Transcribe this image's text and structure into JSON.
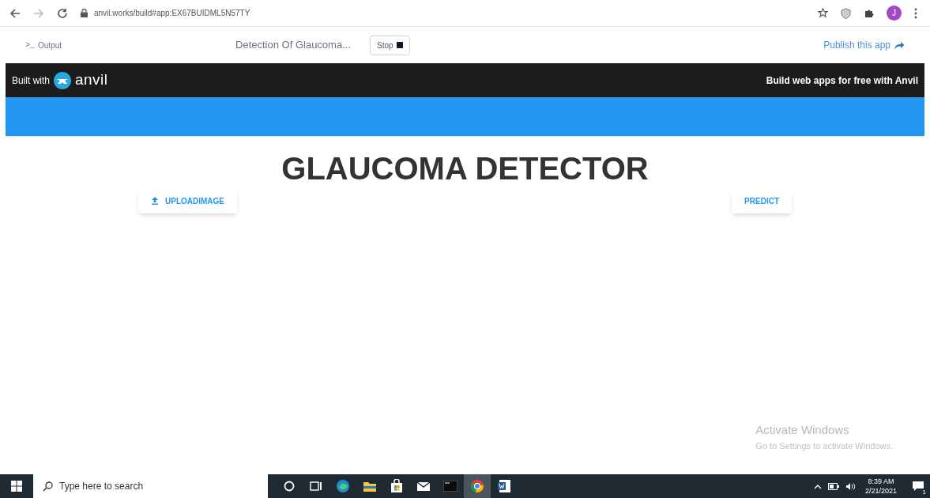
{
  "browser": {
    "url": "anvil.works/build#app:EX67BUIDML5N57TY",
    "avatar": "J"
  },
  "app_header": {
    "output_label": "Output",
    "output_glyph": ">_",
    "title": "Detection Of Glaucoma...",
    "stop_label": "Stop",
    "publish_label": "Publish this app"
  },
  "anvil_bar": {
    "built_with": "Built with",
    "logo_text": "anvil",
    "tagline": "Build web apps for free with Anvil"
  },
  "page": {
    "heading": "GLAUCOMA DETECTOR",
    "buttons": [
      {
        "label": "UPLOADIMAGE",
        "kind": "upload"
      },
      {
        "label": "PREDICT",
        "kind": "plain"
      }
    ]
  },
  "activation": {
    "title": "Activate Windows",
    "subtitle": "Go to Settings to activate Windows."
  },
  "taskbar": {
    "search_placeholder": "Type here to search",
    "apps": [
      {
        "kind": "cortana",
        "selected": false
      },
      {
        "kind": "taskview",
        "selected": false
      },
      {
        "kind": "edge",
        "selected": false
      },
      {
        "kind": "explorer",
        "selected": false
      },
      {
        "kind": "store",
        "selected": false
      },
      {
        "kind": "mail",
        "selected": false
      },
      {
        "kind": "terminal",
        "selected": false
      },
      {
        "kind": "chrome",
        "selected": true
      },
      {
        "kind": "word",
        "selected": false
      }
    ],
    "time": "8:39 AM",
    "date": "2/21/2021",
    "notification_count": "1"
  }
}
